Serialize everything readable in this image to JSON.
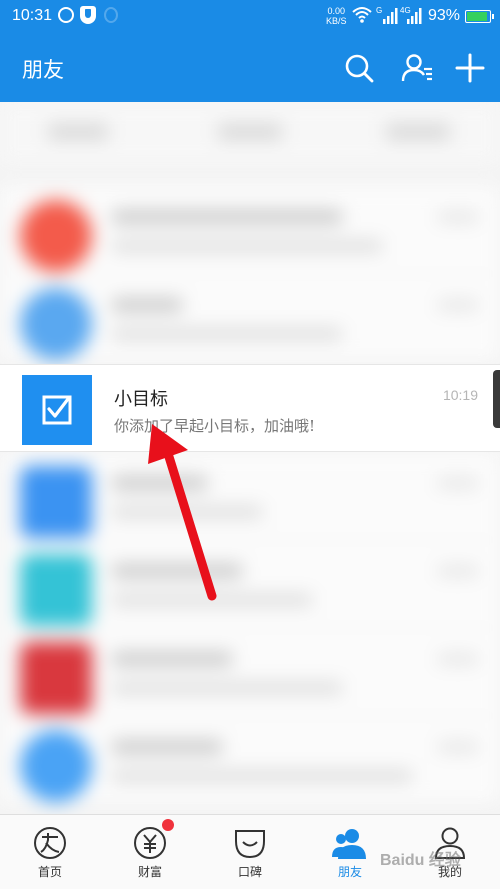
{
  "status_bar": {
    "time": "10:31",
    "net_speed_value": "0.00",
    "net_speed_unit": "KB/S",
    "sim1_label": "G",
    "sim2_label": "4G",
    "battery_percent": "93%",
    "battery_level": 0.93
  },
  "appbar": {
    "title": "朋友",
    "icons": [
      "search-icon",
      "contacts-icon",
      "add-icon"
    ]
  },
  "highlighted_item": {
    "title": "小目标",
    "subtitle": "你添加了早起小目标，加油哦!",
    "time": "10:19",
    "icon": "checkbox-icon"
  },
  "tabs": [
    {
      "label": "首页",
      "icon": "home-icon"
    },
    {
      "label": "财富",
      "icon": "wealth-icon",
      "badge": true
    },
    {
      "label": "口碑",
      "icon": "koubei-icon"
    },
    {
      "label": "朋友",
      "icon": "friends-icon",
      "active": true
    },
    {
      "label": "我的",
      "icon": "profile-icon"
    }
  ],
  "watermark": "Baidu 经验",
  "colors": {
    "brand_blue": "#1a8be6",
    "badge_red": "#f0323c",
    "arrow_red": "#e8101b"
  }
}
